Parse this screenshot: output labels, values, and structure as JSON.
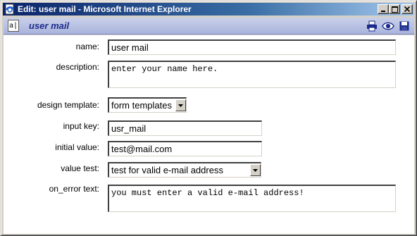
{
  "window": {
    "title": "Edit: user mail - Microsoft Internet Explorer",
    "minimize": "_",
    "maximize": "□",
    "close": "×"
  },
  "toolbar": {
    "doc_icon_glyph": "a|",
    "title": "user mail",
    "icons": [
      "printer-icon",
      "eye-icon",
      "save-disk-icon"
    ]
  },
  "form": {
    "name": {
      "label": "name:",
      "value": "user mail"
    },
    "description": {
      "label": "description:",
      "value": "enter your name here."
    },
    "design_template": {
      "label": "design template:",
      "selected": "form templates"
    },
    "input_key": {
      "label": "input key:",
      "value": "usr_mail"
    },
    "initial_value": {
      "label": "initial value:",
      "value": "test@mail.com"
    },
    "value_test": {
      "label": "value test:",
      "selected": "test for valid e-mail address"
    },
    "on_error_text": {
      "label": "on_error text:",
      "value": "you must enter a valid e-mail address!"
    }
  },
  "colors": {
    "titlebar_start": "#0a246a",
    "titlebar_end": "#a6caf0",
    "toolbar_bg": "#aab4dc",
    "toolbar_title": "#1a2a8a"
  }
}
